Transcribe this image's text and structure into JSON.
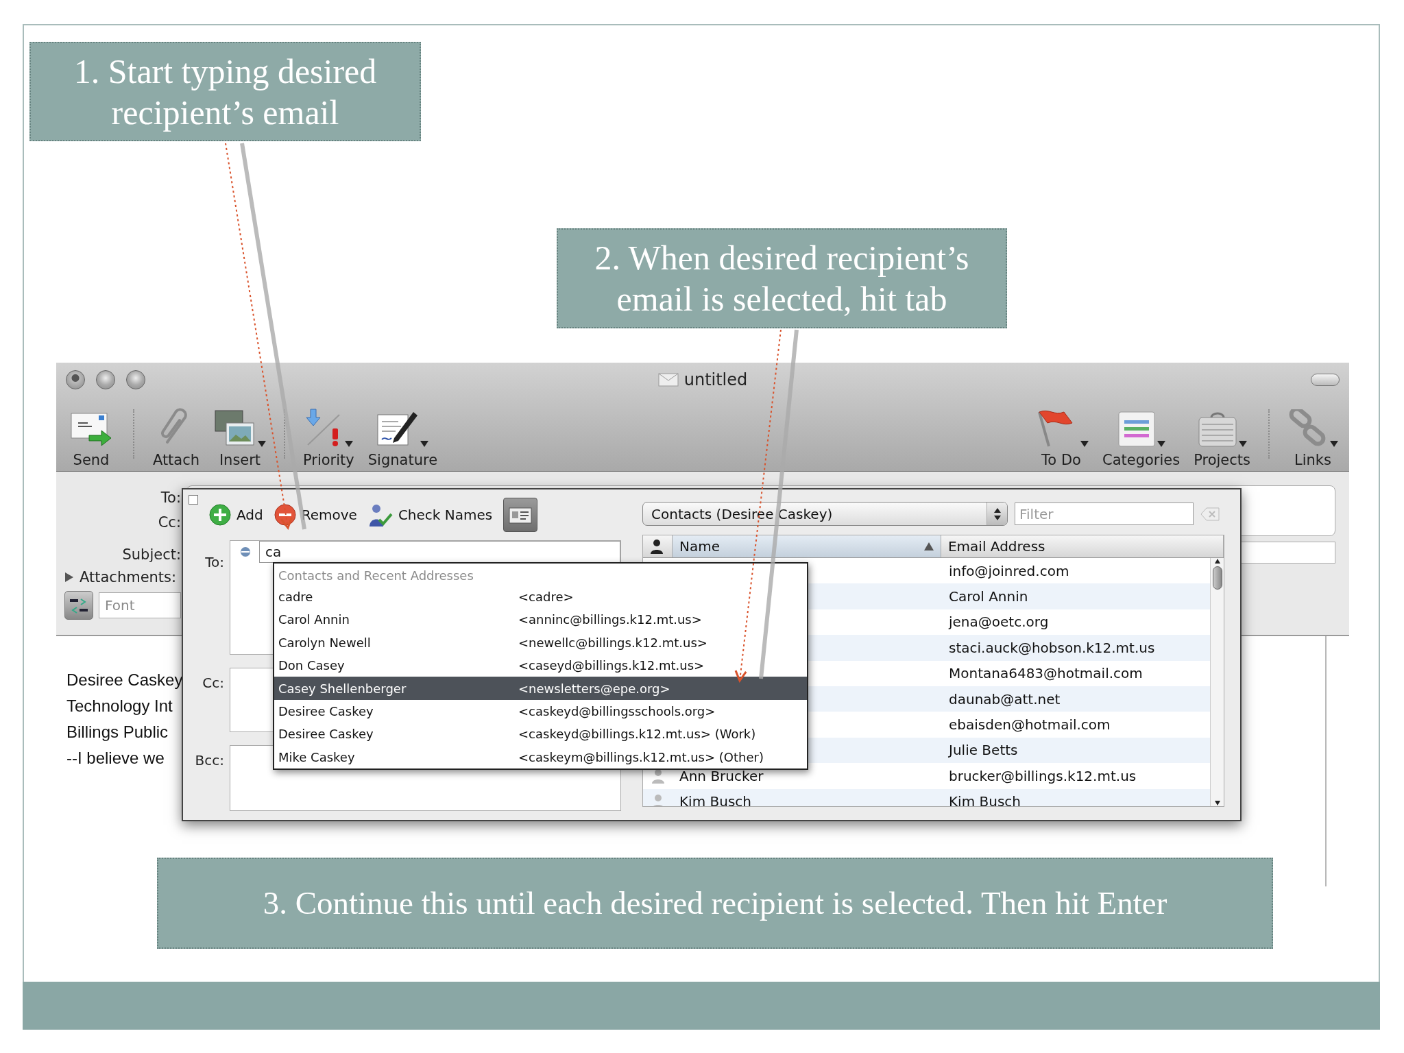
{
  "callouts": [
    {
      "text": "1. Start typing desired recipient’s email"
    },
    {
      "text": "2. When desired recipient’s email is selected, hit tab"
    },
    {
      "text": "3. Continue this until each desired recipient is selected. Then hit Enter"
    }
  ],
  "window": {
    "title": "untitled",
    "toolbar_left": [
      {
        "label": "Send",
        "menu": false
      },
      {
        "label": "Attach",
        "menu": false
      },
      {
        "label": "Insert",
        "menu": true
      },
      {
        "label": "Priority",
        "menu": true
      },
      {
        "label": "Signature",
        "menu": true
      }
    ],
    "toolbar_right": [
      {
        "label": "To Do",
        "menu": true
      },
      {
        "label": "Categories",
        "menu": true
      },
      {
        "label": "Projects",
        "menu": true
      },
      {
        "label": "Links",
        "menu": true
      }
    ],
    "header": {
      "to_label": "To:",
      "cc_label": "Cc:",
      "subject_label": "Subject:",
      "attachments": {
        "label": "Attachments:",
        "expanded": false
      },
      "font": {
        "placeholder": "Font"
      }
    },
    "body_lines": [
      "Desiree Caskey",
      "Technology Int",
      "Billings Public",
      "--I believe we"
    ]
  },
  "dialog": {
    "checkbox": {
      "checked": false
    },
    "toolbar": [
      {
        "label": "Add"
      },
      {
        "label": "Remove"
      },
      {
        "label": "Check Names"
      }
    ],
    "recipients": [
      {
        "label": "To:",
        "value": "ca"
      },
      {
        "label": "Cc:"
      },
      {
        "label": "Bcc:"
      }
    ],
    "address_book": {
      "source": "Contacts (Desiree Caskey)",
      "filter_placeholder": "Filter",
      "columns": [
        {
          "label": "Name",
          "sorted": true
        },
        {
          "label": "Email Address",
          "sorted": false
        }
      ],
      "rows": [
        {
          "email": "info@joinred.com"
        },
        {
          "email": "Carol Annin"
        },
        {
          "email": "jena@oetc.org"
        },
        {
          "email": "staci.auck@hobson.k12.mt.us"
        },
        {
          "email": "Montana6483@hotmail.com"
        },
        {
          "email": "daunab@att.net"
        },
        {
          "email": "ebaisden@hotmail.com"
        },
        {
          "email": "Julie Betts"
        },
        {
          "name": "Ann Brucker",
          "email": "brucker@billings.k12.mt.us"
        },
        {
          "name": "Kim Busch",
          "email": "Kim Busch"
        }
      ]
    },
    "autocomplete": {
      "heading": "Contacts and Recent Addresses",
      "items": [
        {
          "name": "cadre",
          "address": "<cadre>",
          "selected": false
        },
        {
          "name": "Carol Annin",
          "address": "<anninc@billings.k12.mt.us>",
          "selected": false
        },
        {
          "name": "Carolyn Newell",
          "address": "<newellc@billings.k12.mt.us>",
          "selected": false
        },
        {
          "name": "Don Casey",
          "address": "<caseyd@billings.k12.mt.us>",
          "selected": false
        },
        {
          "name": "Casey Shellenberger",
          "address": "<newsletters@epe.org>",
          "selected": true
        },
        {
          "name": "Desiree Caskey",
          "address": "<caskeyd@billingsschools.org>",
          "selected": false
        },
        {
          "name": "Desiree Caskey",
          "address": "<caskeyd@billings.k12.mt.us> (Work)",
          "selected": false
        },
        {
          "name": "Mike Caskey",
          "address": "<caskeym@billings.k12.mt.us> (Other)",
          "selected": false
        }
      ]
    }
  }
}
